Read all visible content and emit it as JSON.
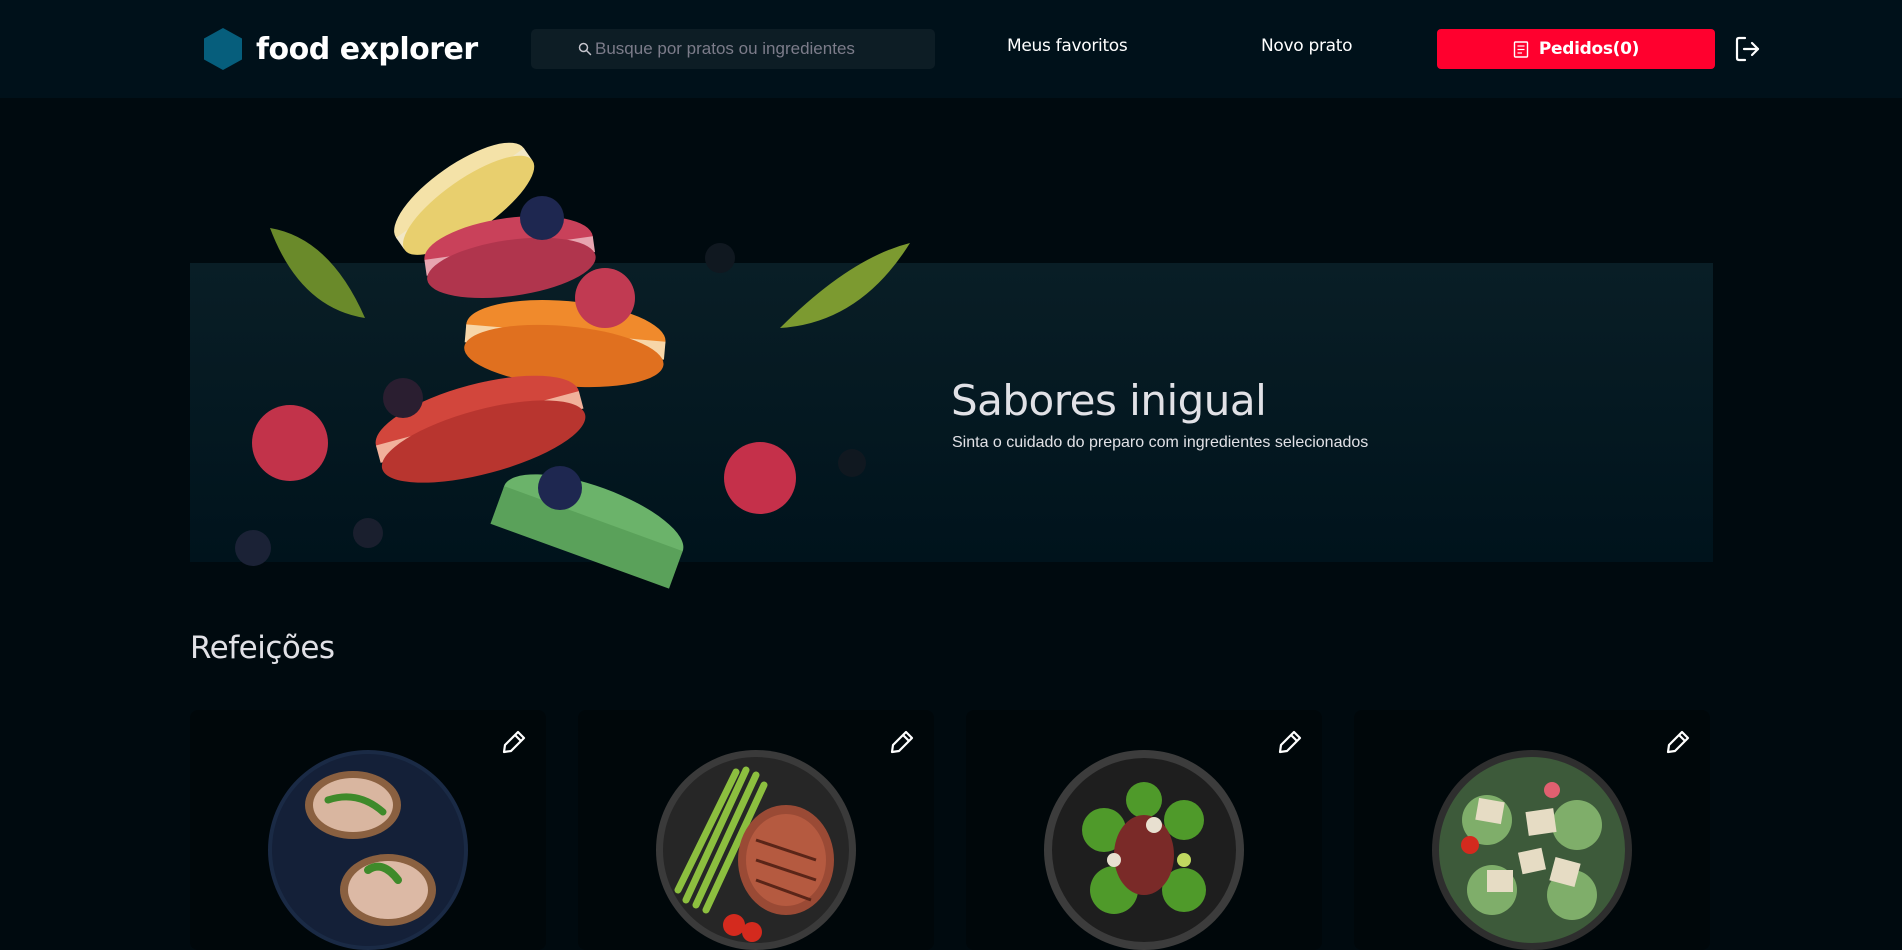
{
  "header": {
    "logo_text": "food explorer",
    "search": {
      "placeholder": "Busque por pratos ou ingredientes",
      "value": ""
    },
    "nav": {
      "favorites_label": "Meus favoritos",
      "new_dish_label": "Novo prato"
    },
    "orders": {
      "label": "Pedidos(0)"
    },
    "icons": {
      "logo": "hexagon-logo-icon",
      "search": "search-icon",
      "orders": "receipt-icon",
      "logout": "sign-out-icon"
    }
  },
  "banner": {
    "title": "Sabores inigual",
    "subtitle": "Sinta o cuidado do preparo com ingredientes selecionados"
  },
  "section": {
    "title": "Refeições",
    "cards": [
      {
        "edit_icon": "pencil-icon",
        "image": "bruschetta-dish"
      },
      {
        "edit_icon": "pencil-icon",
        "image": "steak-asparagus-dish"
      },
      {
        "edit_icon": "pencil-icon",
        "image": "salad-dish"
      },
      {
        "edit_icon": "pencil-icon",
        "image": "caesar-salad-dish"
      }
    ]
  },
  "colors": {
    "background": "#000a0f",
    "header_bg": "#00111a",
    "accent": "#ff002e",
    "logo": "#065e7c",
    "banner_bg": "#091e26"
  }
}
